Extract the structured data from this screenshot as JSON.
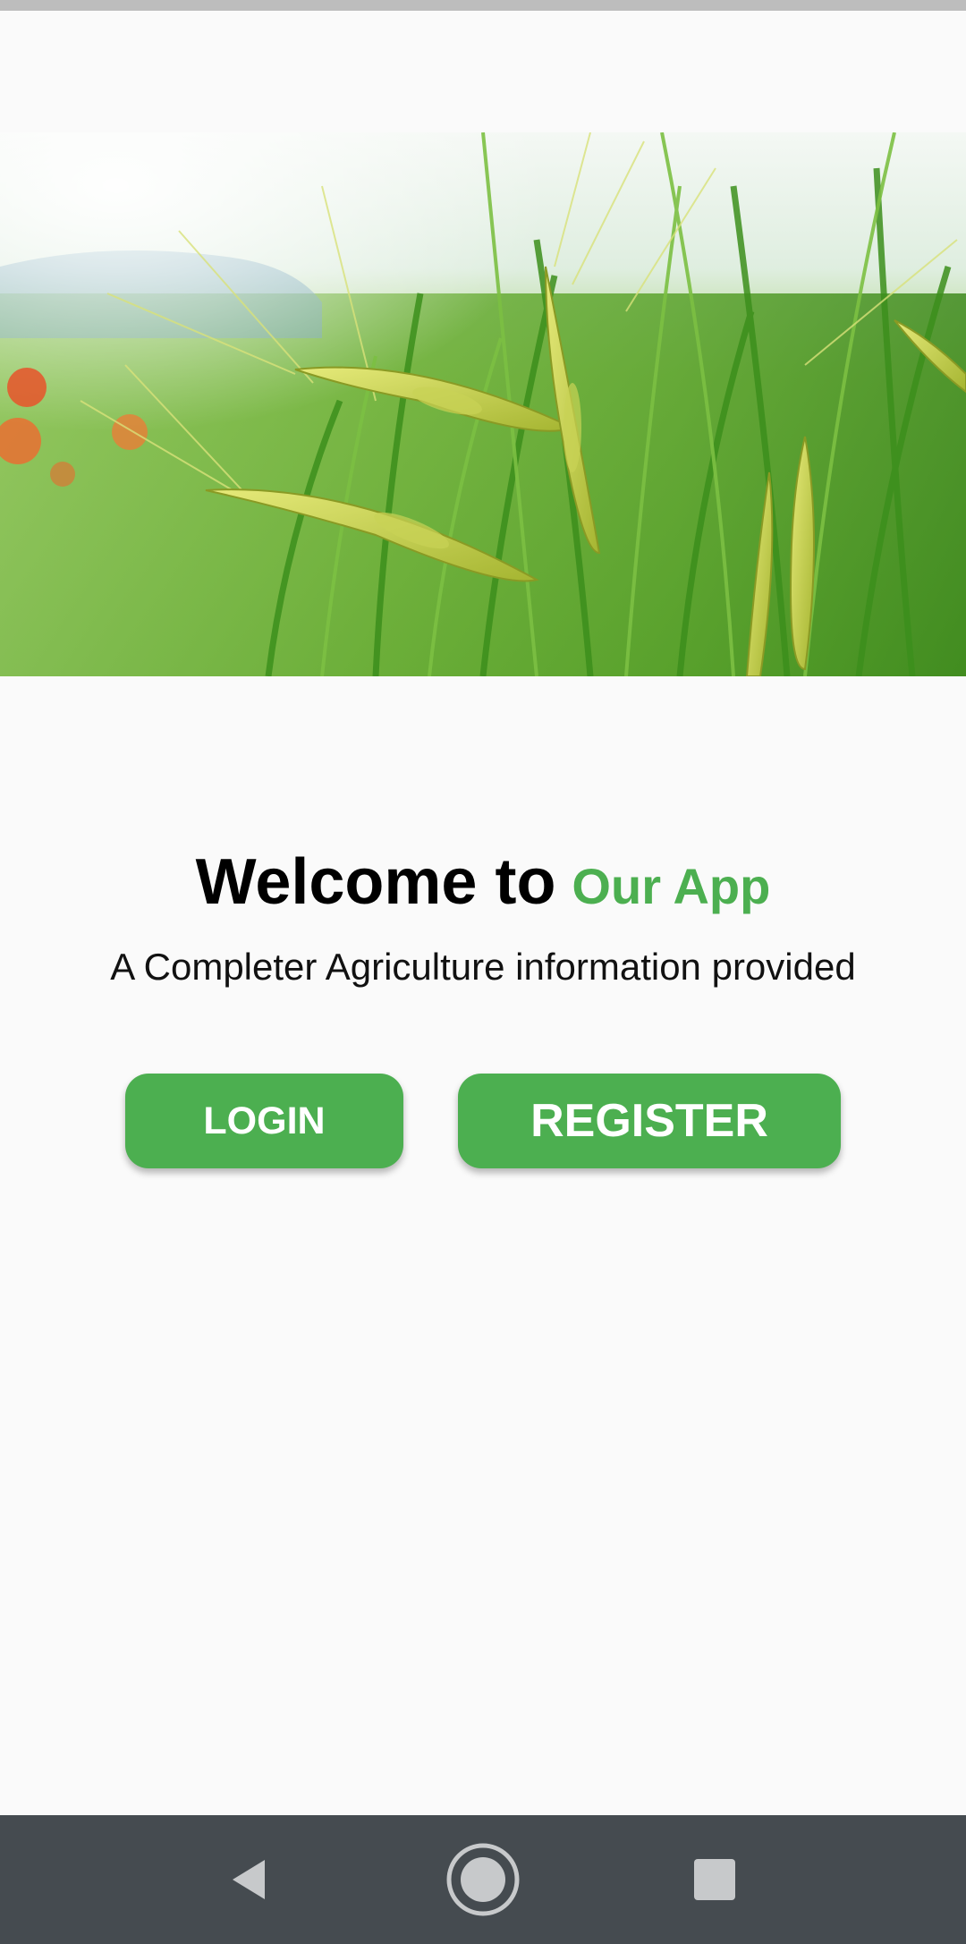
{
  "hero": {
    "image": "wheat-field-photo"
  },
  "welcome": {
    "prefix": "Welcome to",
    "app_name": "Our App"
  },
  "tagline": "A Completer Agriculture information provided",
  "buttons": {
    "login_label": "LOGIN",
    "register_label": "REGISTER"
  },
  "colors": {
    "accent": "#4caf50",
    "background": "#fafafa",
    "navbar": "#454b50"
  },
  "navbar": {
    "icons": [
      "back-icon",
      "home-icon",
      "recents-icon"
    ]
  }
}
